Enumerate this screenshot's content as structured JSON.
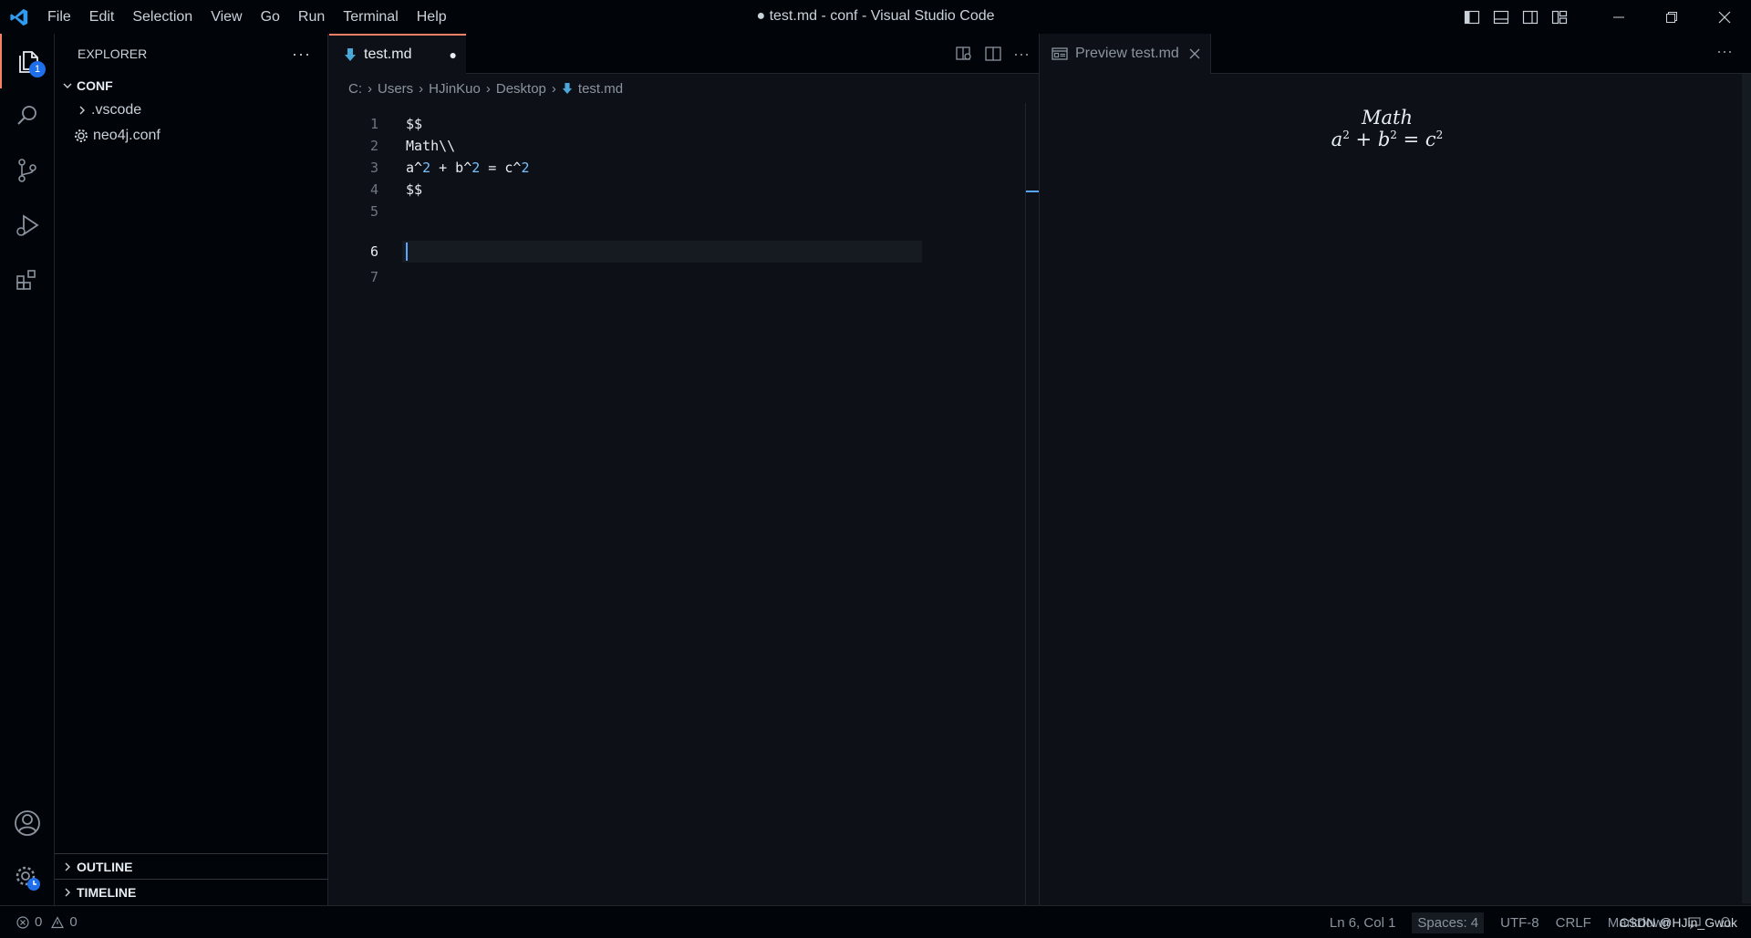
{
  "window": {
    "title": "● test.md - conf - Visual Studio Code",
    "menu": [
      "File",
      "Edit",
      "Selection",
      "View",
      "Go",
      "Run",
      "Terminal",
      "Help"
    ]
  },
  "activity": {
    "explorer_badge": "1"
  },
  "sidebar": {
    "header": "EXPLORER",
    "more": "···",
    "folder": "CONF",
    "items": [
      {
        "label": ".vscode",
        "kind": "folder"
      },
      {
        "label": "neo4j.conf",
        "kind": "file"
      }
    ],
    "outline": "OUTLINE",
    "timeline": "TIMELINE"
  },
  "editor": {
    "tab_label": "test.md",
    "dirty_marker": "●",
    "more": "···",
    "breadcrumb": [
      "C:",
      "Users",
      "HJinKuo",
      "Desktop",
      "test.md"
    ],
    "lines": [
      {
        "num": "1",
        "text": "$$"
      },
      {
        "num": "2",
        "text": "Math\\\\"
      },
      {
        "num": "3",
        "text": "a^2 + b^2 = c^2"
      },
      {
        "num": "4",
        "text": "$$"
      },
      {
        "num": "5",
        "text": ""
      },
      {
        "num": "6",
        "text": ""
      },
      {
        "num": "7",
        "text": ""
      }
    ],
    "current_line": "6"
  },
  "preview": {
    "tab_label": "Preview test.md",
    "more": "···",
    "math_line1": "Math",
    "math_line2_a": "a",
    "math_line2_b": "b",
    "math_line2_c": "c",
    "exp": "2",
    "plus": "+",
    "equals": "="
  },
  "status": {
    "errors": "0",
    "warnings": "0",
    "position": "Ln 6, Col 1",
    "spaces": "Spaces: 4",
    "encoding": "UTF-8",
    "eol": "CRLF",
    "language": "Markdown",
    "watermark": "CSDN @HJin_Gwok"
  },
  "colors": {
    "accent": "#f78166",
    "badge": "#1f6feb",
    "vscode_blue": "#2f9bf0"
  }
}
